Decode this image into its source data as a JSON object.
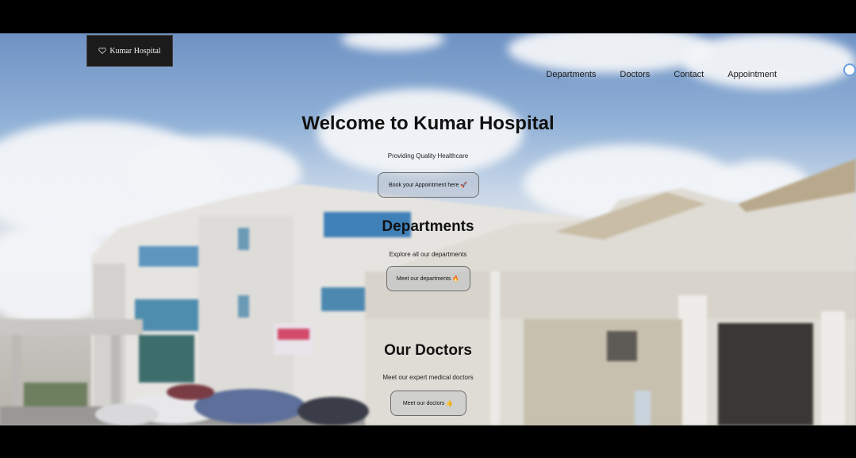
{
  "header": {
    "logo_text": "Kumar Hospital"
  },
  "nav": {
    "items": [
      "Departments",
      "Doctors",
      "Contact",
      "Appointment"
    ]
  },
  "hero": {
    "title": "Welcome to Kumar Hospital",
    "subtitle": "Providing Quality Healthcare",
    "button_label": "Book your Appointment here 🚀"
  },
  "departments": {
    "title": "Departments",
    "subtitle": "Explore all our departments",
    "button_label": "Meet our departments 🔥"
  },
  "doctors": {
    "title": "Our Doctors",
    "subtitle": "Meet our expert medical doctors",
    "button_label": "Meet our doctors 👍"
  },
  "colors": {
    "accent": "#6aa0e0",
    "logo_bg": "#1b1b1b"
  }
}
